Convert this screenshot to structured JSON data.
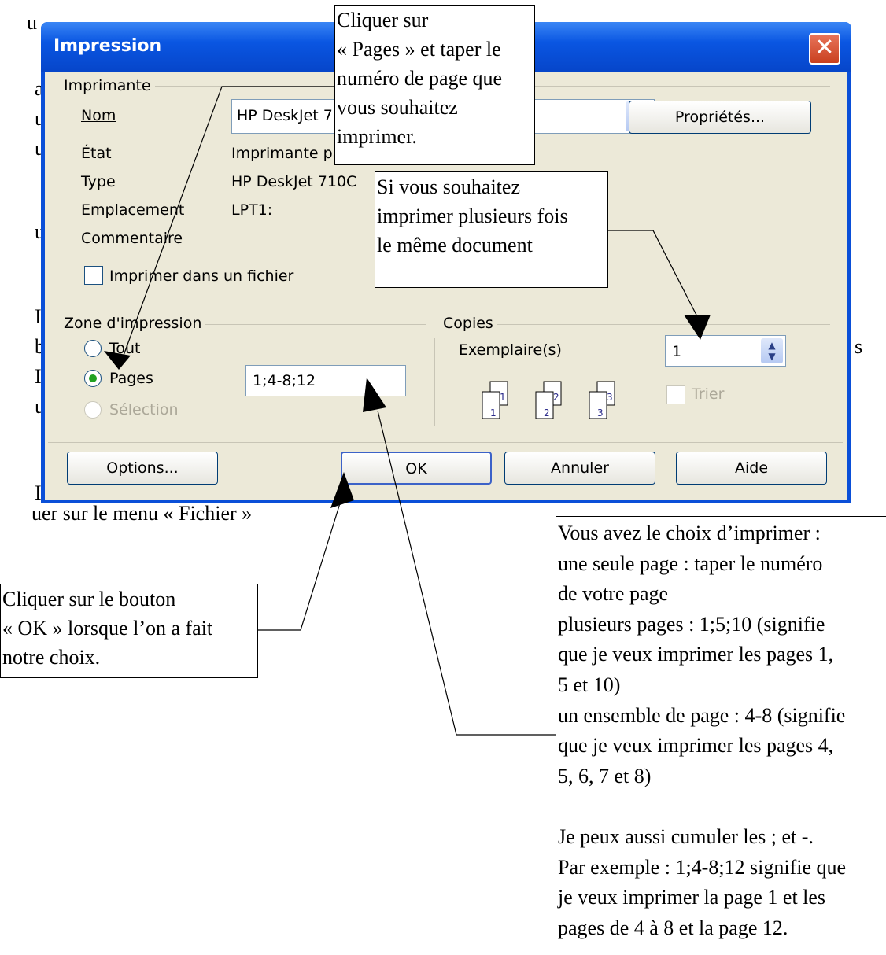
{
  "background": {
    "fragments": [
      "u",
      "a",
      "u",
      "u",
      "u",
      "I",
      "b",
      "I",
      "u",
      "I",
      "s",
      "uer sur le menu « Fichier »"
    ]
  },
  "dialog": {
    "title": "Impression",
    "close_glyph": "✕",
    "printer_group": {
      "label": "Imprimante",
      "name_label": "Nom",
      "name_value": "HP DeskJet 710C",
      "status_label": "État",
      "status_value": "Imprimante par défaut",
      "type_label": "Type",
      "type_value": "HP DeskJet 710C",
      "location_label": "Emplacement",
      "location_value": "LPT1:",
      "comment_label": "Commentaire",
      "print_to_file": "Imprimer dans un fichier",
      "properties_button": "Propriétés..."
    },
    "print_range": {
      "label": "Zone d'impression",
      "all": "Tout",
      "pages": "Pages",
      "selection": "Sélection",
      "pages_value": "1;4-8;12"
    },
    "copies": {
      "label": "Copies",
      "count_label": "Exemplaire(s)",
      "count_value": "1",
      "collate": "Trier",
      "page_numbers": [
        "1",
        "1",
        "2",
        "2",
        "3",
        "3"
      ]
    },
    "buttons": {
      "options": "Options...",
      "ok": "OK",
      "cancel": "Annuler",
      "help": "Aide"
    }
  },
  "callouts": {
    "pages": [
      "Cliquer sur",
      "« Pages » et taper le",
      "numéro de page que",
      "vous souhaitez",
      "imprimer."
    ],
    "copies": [
      "Si vous souhaitez",
      "imprimer plusieurs fois",
      "le même document"
    ],
    "ok": [
      "Cliquer sur le bouton",
      "« OK » lorsque l’on a fait",
      "notre choix."
    ],
    "range": [
      "Vous avez le choix d’imprimer :",
      "une seule page : taper le numéro",
      "de votre page",
      "plusieurs pages : 1;5;10 (signifie",
      "que je veux imprimer les pages 1,",
      "5 et 10)",
      "un ensemble de page : 4-8 (signifie",
      "que je veux imprimer les pages 4,",
      "5, 6, 7 et 8)",
      "",
      "Je peux aussi cumuler les ; et -.",
      "Par exemple : 1;4-8;12 signifie que",
      "je veux imprimer la page 1 et les",
      "pages de 4 à 8 et la page 12."
    ]
  }
}
